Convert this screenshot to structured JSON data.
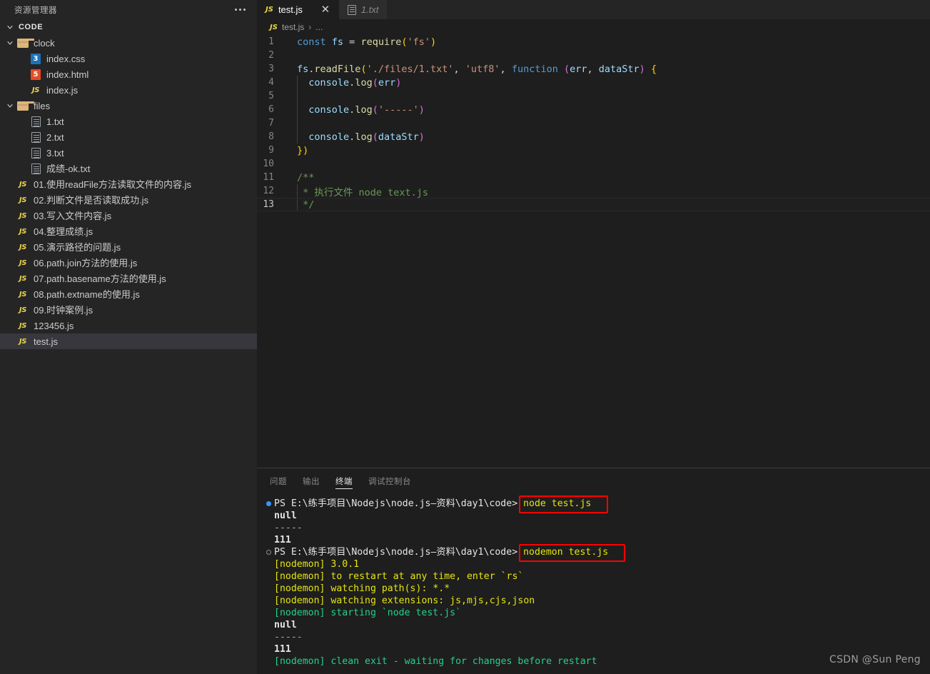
{
  "sidebar": {
    "title": "资源管理器",
    "more_icon": "ellipsis-icon",
    "root_label": "CODE",
    "items": [
      {
        "label": "clock",
        "icon": "folder-icon",
        "depth": 1,
        "type": "folder",
        "expanded": true
      },
      {
        "label": "index.css",
        "icon": "css-file-icon",
        "depth": 2,
        "type": "css"
      },
      {
        "label": "index.html",
        "icon": "html-file-icon",
        "depth": 2,
        "type": "html"
      },
      {
        "label": "index.js",
        "icon": "js-file-icon",
        "depth": 2,
        "type": "js"
      },
      {
        "label": "files",
        "icon": "folder-icon",
        "depth": 1,
        "type": "folder",
        "expanded": true
      },
      {
        "label": "1.txt",
        "icon": "text-file-icon",
        "depth": 2,
        "type": "txt"
      },
      {
        "label": "2.txt",
        "icon": "text-file-icon",
        "depth": 2,
        "type": "txt"
      },
      {
        "label": "3.txt",
        "icon": "text-file-icon",
        "depth": 2,
        "type": "txt"
      },
      {
        "label": "成绩-ok.txt",
        "icon": "text-file-icon",
        "depth": 2,
        "type": "txt"
      },
      {
        "label": "01.使用readFile方法读取文件的内容.js",
        "icon": "js-file-icon",
        "depth": 1,
        "type": "js"
      },
      {
        "label": "02.判断文件是否读取成功.js",
        "icon": "js-file-icon",
        "depth": 1,
        "type": "js"
      },
      {
        "label": "03.写入文件内容.js",
        "icon": "js-file-icon",
        "depth": 1,
        "type": "js"
      },
      {
        "label": "04.整理成绩.js",
        "icon": "js-file-icon",
        "depth": 1,
        "type": "js"
      },
      {
        "label": "05.演示路径的问题.js",
        "icon": "js-file-icon",
        "depth": 1,
        "type": "js"
      },
      {
        "label": "06.path.join方法的使用.js",
        "icon": "js-file-icon",
        "depth": 1,
        "type": "js"
      },
      {
        "label": "07.path.basename方法的使用.js",
        "icon": "js-file-icon",
        "depth": 1,
        "type": "js"
      },
      {
        "label": "08.path.extname的使用.js",
        "icon": "js-file-icon",
        "depth": 1,
        "type": "js"
      },
      {
        "label": "09.时钟案例.js",
        "icon": "js-file-icon",
        "depth": 1,
        "type": "js"
      },
      {
        "label": "123456.js",
        "icon": "js-file-icon",
        "depth": 1,
        "type": "js"
      },
      {
        "label": "test.js",
        "icon": "js-file-icon",
        "depth": 1,
        "type": "js",
        "selected": true
      }
    ]
  },
  "editor": {
    "tabs": [
      {
        "label": "test.js",
        "icon": "js-file-icon",
        "active": true,
        "close_icon": "close-icon",
        "close_glyph": "✕"
      },
      {
        "label": "1.txt",
        "icon": "text-file-icon",
        "active": false
      }
    ],
    "breadcrumb": {
      "icon": "js-file-icon",
      "file": "test.js",
      "separator": "›",
      "rest": "..."
    },
    "active_line": 13,
    "lines": [
      {
        "n": 1,
        "tokens": [
          {
            "t": "const ",
            "c": "t-kw"
          },
          {
            "t": "fs",
            "c": "t-var"
          },
          {
            "t": " = ",
            "c": "t-op"
          },
          {
            "t": "require",
            "c": "t-fn"
          },
          {
            "t": "(",
            "c": "t-punc"
          },
          {
            "t": "'fs'",
            "c": "t-str"
          },
          {
            "t": ")",
            "c": "t-punc"
          }
        ]
      },
      {
        "n": 2,
        "tokens": []
      },
      {
        "n": 3,
        "tokens": [
          {
            "t": "fs",
            "c": "t-var"
          },
          {
            "t": ".",
            "c": "t-plain"
          },
          {
            "t": "readFile",
            "c": "t-fn"
          },
          {
            "t": "(",
            "c": "t-punc"
          },
          {
            "t": "'./files/1.txt'",
            "c": "t-str"
          },
          {
            "t": ", ",
            "c": "t-plain"
          },
          {
            "t": "'utf8'",
            "c": "t-str"
          },
          {
            "t": ", ",
            "c": "t-plain"
          },
          {
            "t": "function ",
            "c": "t-kw"
          },
          {
            "t": "(",
            "c": "t-punc2"
          },
          {
            "t": "err",
            "c": "t-param"
          },
          {
            "t": ", ",
            "c": "t-plain"
          },
          {
            "t": "dataStr",
            "c": "t-param"
          },
          {
            "t": ")",
            "c": "t-punc2"
          },
          {
            "t": " ",
            "c": "t-plain"
          },
          {
            "t": "{",
            "c": "t-punc"
          }
        ]
      },
      {
        "n": 4,
        "indent": 1,
        "tokens": [
          {
            "t": "  ",
            "c": "t-plain"
          },
          {
            "t": "console",
            "c": "t-var"
          },
          {
            "t": ".",
            "c": "t-plain"
          },
          {
            "t": "log",
            "c": "t-fn"
          },
          {
            "t": "(",
            "c": "t-punc2"
          },
          {
            "t": "err",
            "c": "t-var"
          },
          {
            "t": ")",
            "c": "t-punc2"
          }
        ]
      },
      {
        "n": 5,
        "indent": 1,
        "tokens": []
      },
      {
        "n": 6,
        "indent": 1,
        "tokens": [
          {
            "t": "  ",
            "c": "t-plain"
          },
          {
            "t": "console",
            "c": "t-var"
          },
          {
            "t": ".",
            "c": "t-plain"
          },
          {
            "t": "log",
            "c": "t-fn"
          },
          {
            "t": "(",
            "c": "t-punc2"
          },
          {
            "t": "'-----'",
            "c": "t-str"
          },
          {
            "t": ")",
            "c": "t-punc2"
          }
        ]
      },
      {
        "n": 7,
        "indent": 1,
        "tokens": []
      },
      {
        "n": 8,
        "indent": 1,
        "tokens": [
          {
            "t": "  ",
            "c": "t-plain"
          },
          {
            "t": "console",
            "c": "t-var"
          },
          {
            "t": ".",
            "c": "t-plain"
          },
          {
            "t": "log",
            "c": "t-fn"
          },
          {
            "t": "(",
            "c": "t-punc2"
          },
          {
            "t": "dataStr",
            "c": "t-var"
          },
          {
            "t": ")",
            "c": "t-punc2"
          }
        ]
      },
      {
        "n": 9,
        "tokens": [
          {
            "t": "}",
            "c": "t-punc"
          },
          {
            "t": ")",
            "c": "t-punc"
          }
        ]
      },
      {
        "n": 10,
        "tokens": []
      },
      {
        "n": 11,
        "tokens": [
          {
            "t": "/**",
            "c": "t-cmt"
          }
        ]
      },
      {
        "n": 12,
        "indent": 1,
        "tokens": [
          {
            "t": " * 执行文件 node text.js",
            "c": "t-cmt"
          }
        ]
      },
      {
        "n": 13,
        "indent": 1,
        "tokens": [
          {
            "t": " */",
            "c": "t-cmt"
          }
        ]
      }
    ]
  },
  "panel": {
    "tabs": [
      {
        "label": "问题",
        "active": false
      },
      {
        "label": "输出",
        "active": false
      },
      {
        "label": "终端",
        "active": true
      },
      {
        "label": "调试控制台",
        "active": false
      }
    ],
    "terminal_lines": [
      {
        "mark": "dot-filled",
        "parts": [
          {
            "t": "PS E:\\练手项目\\Nodejs\\node.js—资料\\day1\\code> ",
            "c": "c-path"
          }
        ],
        "boxed": {
          "text": "node test.js",
          "prefix_color": "c-yellow",
          "suffix_color": "c-gray"
        }
      },
      {
        "mark": "",
        "parts": [
          {
            "t": "null",
            "c": "c-white"
          }
        ]
      },
      {
        "mark": "",
        "parts": [
          {
            "t": "-----",
            "c": "c-gray"
          }
        ]
      },
      {
        "mark": "",
        "parts": [
          {
            "t": "111",
            "c": "c-white"
          }
        ]
      },
      {
        "mark": "dot-hollow",
        "parts": [
          {
            "t": "PS E:\\练手项目\\Nodejs\\node.js—资料\\day1\\code> ",
            "c": "c-path"
          }
        ],
        "boxed": {
          "text": "nodemon test.js",
          "prefix_color": "c-yellow",
          "suffix_color": "c-gray"
        }
      },
      {
        "mark": "",
        "parts": [
          {
            "t": "[nodemon] ",
            "c": "c-yellow"
          },
          {
            "t": "3.0.1",
            "c": "c-yellow"
          }
        ]
      },
      {
        "mark": "",
        "parts": [
          {
            "t": "[nodemon] ",
            "c": "c-yellow"
          },
          {
            "t": "to restart at any time, enter `rs`",
            "c": "c-yellow"
          }
        ]
      },
      {
        "mark": "",
        "parts": [
          {
            "t": "[nodemon] ",
            "c": "c-yellow"
          },
          {
            "t": "watching path(s): *.*",
            "c": "c-yellow"
          }
        ]
      },
      {
        "mark": "",
        "parts": [
          {
            "t": "[nodemon] ",
            "c": "c-yellow"
          },
          {
            "t": "watching extensions: js,mjs,cjs,json",
            "c": "c-yellow"
          }
        ]
      },
      {
        "mark": "",
        "parts": [
          {
            "t": "[nodemon] starting `node test.js`",
            "c": "c-green"
          }
        ]
      },
      {
        "mark": "",
        "parts": [
          {
            "t": "null",
            "c": "c-white"
          }
        ]
      },
      {
        "mark": "",
        "parts": [
          {
            "t": "-----",
            "c": "c-gray"
          }
        ]
      },
      {
        "mark": "",
        "parts": [
          {
            "t": "111",
            "c": "c-white"
          }
        ]
      },
      {
        "mark": "",
        "parts": [
          {
            "t": "[nodemon] clean exit - waiting for changes before restart",
            "c": "c-green"
          }
        ]
      }
    ],
    "highlight_color": "#ff0000"
  },
  "watermark": "CSDN @Sun  Peng"
}
